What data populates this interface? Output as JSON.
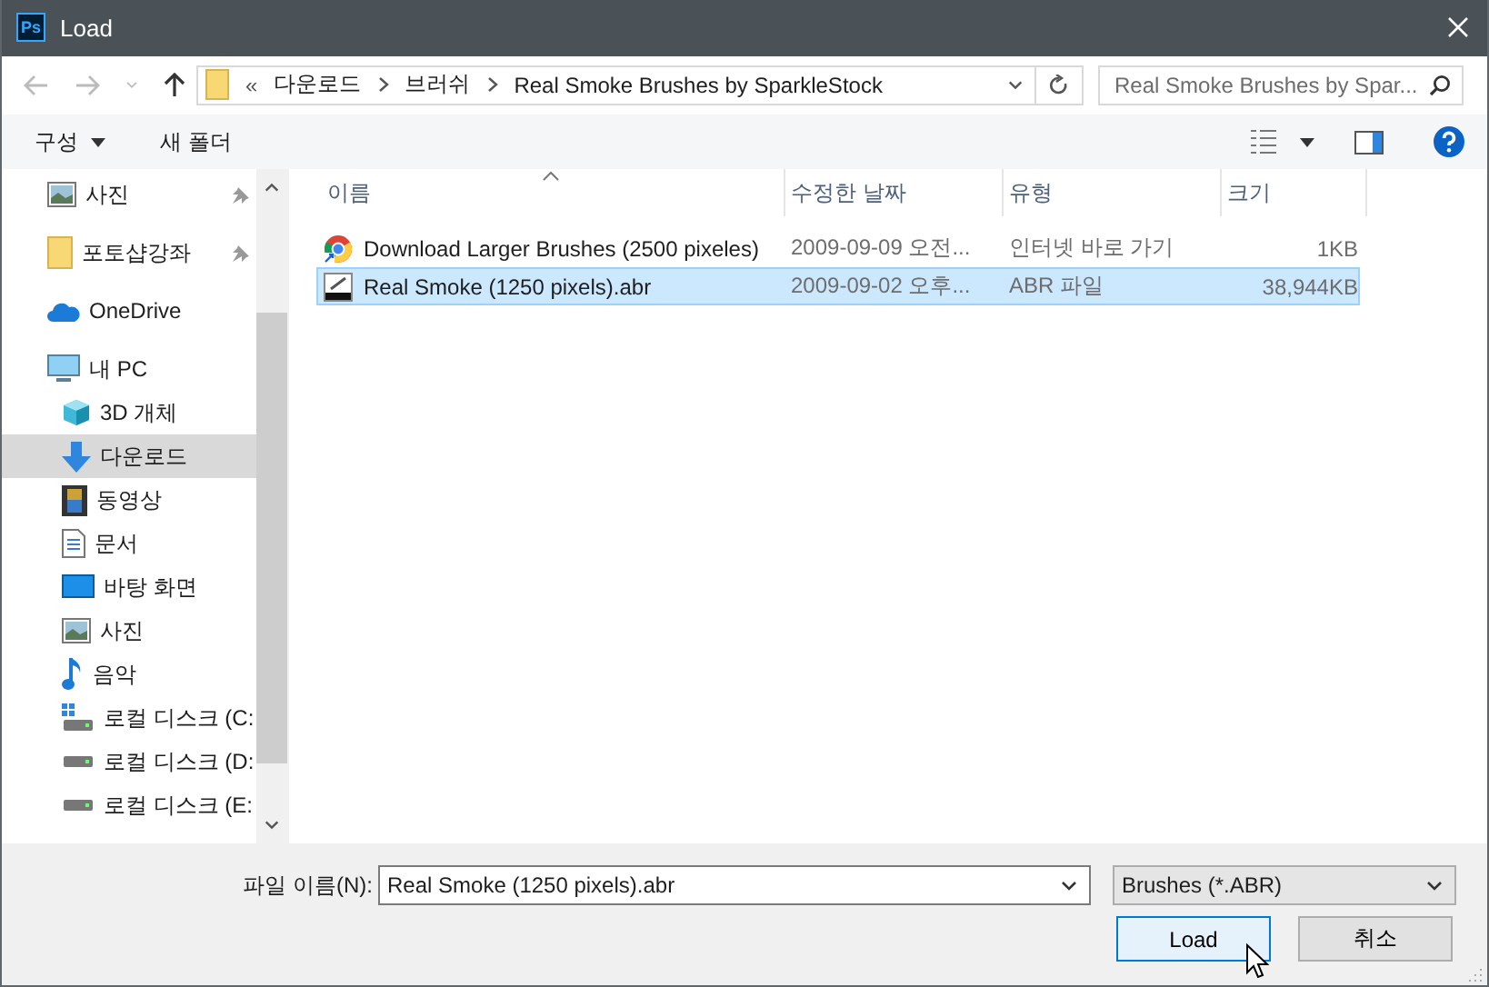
{
  "window": {
    "app_icon_text": "Ps",
    "title": "Load"
  },
  "address": {
    "overflow": "«",
    "crumbs": [
      "다운로드",
      "브러쉬",
      "Real Smoke Brushes by SparkleStock"
    ]
  },
  "search": {
    "placeholder": "Real Smoke Brushes by Spar..."
  },
  "toolbar": {
    "organize": "구성",
    "new_folder": "새 폴더"
  },
  "sidebar": {
    "items": [
      {
        "label": "사진",
        "kind": "picture",
        "pinned": true,
        "selected": false
      },
      {
        "label": "포토샵강좌",
        "kind": "folder",
        "pinned": true,
        "selected": false
      },
      {
        "label": "OneDrive",
        "kind": "cloud",
        "pinned": false,
        "selected": false
      },
      {
        "label": "내 PC",
        "kind": "pc",
        "pinned": false,
        "selected": false,
        "children": [
          {
            "label": "3D 개체",
            "kind": "cube",
            "selected": false
          },
          {
            "label": "다운로드",
            "kind": "download",
            "selected": true
          },
          {
            "label": "동영상",
            "kind": "film",
            "selected": false
          },
          {
            "label": "문서",
            "kind": "document",
            "selected": false
          },
          {
            "label": "바탕 화면",
            "kind": "desktop",
            "selected": false
          },
          {
            "label": "사진",
            "kind": "picture",
            "selected": false
          },
          {
            "label": "음악",
            "kind": "music",
            "selected": false
          },
          {
            "label": "로컬 디스크 (C:",
            "kind": "system-drive",
            "selected": false
          },
          {
            "label": "로컬 디스크 (D:",
            "kind": "drive",
            "selected": false
          },
          {
            "label": "로컬 디스크 (E:",
            "kind": "drive",
            "selected": false
          }
        ]
      }
    ]
  },
  "table": {
    "columns": [
      {
        "label": "이름",
        "sorted": true
      },
      {
        "label": "수정한 날짜",
        "sorted": false
      },
      {
        "label": "유형",
        "sorted": false
      },
      {
        "label": "크기",
        "sorted": false
      }
    ],
    "rows": [
      {
        "kind": "shortcut",
        "name": "Download Larger Brushes (2500 pixeles)",
        "date": "2009-09-09 오전...",
        "type": "인터넷 바로 가기",
        "size": "1KB",
        "selected": false
      },
      {
        "kind": "brush",
        "name": "Real Smoke (1250 pixels).abr",
        "date": "2009-09-02 오후...",
        "type": "ABR 파일",
        "size": "38,944KB",
        "selected": true
      }
    ]
  },
  "footer": {
    "filename_label": "파일 이름(N):",
    "filename": "Real Smoke (1250 pixels).abr",
    "filter": "Brushes (*.ABR)",
    "buttons": [
      {
        "label": "Load",
        "kind": "primary"
      },
      {
        "label": "취소",
        "kind": "normal"
      }
    ]
  }
}
